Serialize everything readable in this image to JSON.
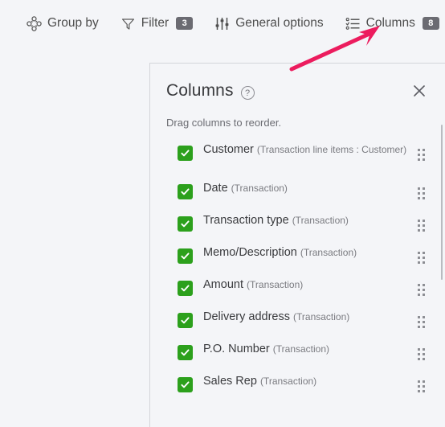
{
  "toolbar": {
    "items": [
      {
        "label": "Group by",
        "icon": "group-by-icon",
        "badge": null
      },
      {
        "label": "Filter",
        "icon": "filter-icon",
        "badge": "3"
      },
      {
        "label": "General options",
        "icon": "sliders-icon",
        "badge": null
      },
      {
        "label": "Columns",
        "icon": "columns-list-icon",
        "badge": "8"
      }
    ],
    "collapse_icon": "chevron-up-circle-icon"
  },
  "panel": {
    "title": "Columns",
    "help_icon": "question-mark-icon",
    "help_glyph": "?",
    "close_icon": "close-icon",
    "subtitle": "Drag columns to reorder.",
    "columns": [
      {
        "name": "Customer",
        "source": "(Transaction line items : Customer)",
        "checked": true,
        "tall": true
      },
      {
        "name": "Date",
        "source": "(Transaction)",
        "checked": true,
        "tall": false
      },
      {
        "name": "Transaction type",
        "source": "(Transaction)",
        "checked": true,
        "tall": false
      },
      {
        "name": "Memo/Description",
        "source": "(Transaction)",
        "checked": true,
        "tall": false
      },
      {
        "name": "Amount",
        "source": "(Transaction)",
        "checked": true,
        "tall": false
      },
      {
        "name": "Delivery address",
        "source": "(Transaction)",
        "checked": true,
        "tall": false
      },
      {
        "name": "P.O. Number",
        "source": "(Transaction)",
        "checked": true,
        "tall": false
      },
      {
        "name": "Sales Rep",
        "source": "(Transaction)",
        "checked": true,
        "tall": false
      }
    ]
  },
  "colors": {
    "checkbox_green": "#2ca01c",
    "badge_gray": "#6b6b72",
    "annotation_pink": "#ec1c5e",
    "background": "#f4f5f8",
    "text_primary": "#393a3d",
    "text_secondary": "#7a7b80"
  },
  "annotation": {
    "arrow_color": "#ec1c5e",
    "points_to": "Columns"
  }
}
